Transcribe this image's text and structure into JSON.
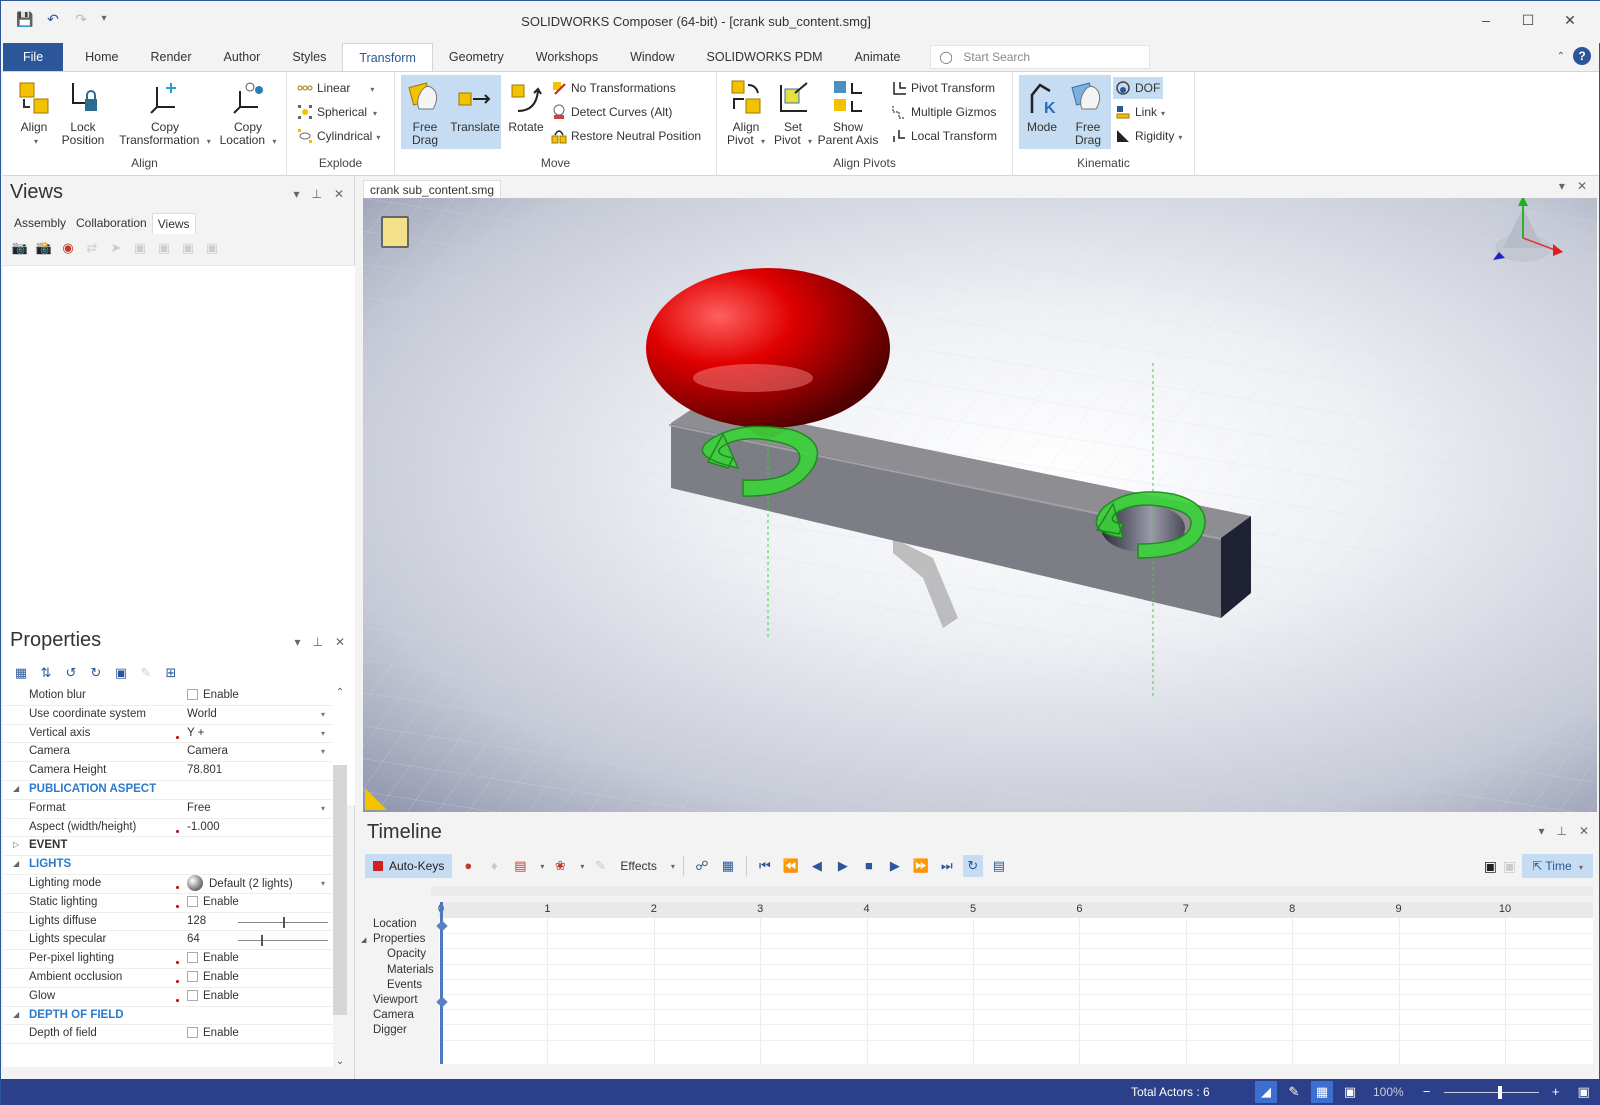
{
  "app": {
    "title": "SOLIDWORKS Composer (64-bit) - [crank sub_content.smg]",
    "quick_access": [
      "save-icon",
      "undo-icon",
      "redo-icon",
      "customize-icon"
    ],
    "window_controls": {
      "minimize": "–",
      "maximize": "☐",
      "close": "✕"
    }
  },
  "ribbon_tabs": [
    "File",
    "Home",
    "Render",
    "Author",
    "Styles",
    "Transform",
    "Geometry",
    "Workshops",
    "Window",
    "SOLIDWORKS PDM",
    "Animate"
  ],
  "active_tab": "Transform",
  "search": {
    "placeholder": "Start Search"
  },
  "ribbon": {
    "align": {
      "label": "Align",
      "buttons": [
        {
          "label": "Align",
          "icon": "align-icon",
          "dropdown": true
        },
        {
          "label": "Lock Position",
          "icon": "lock-position-icon"
        },
        {
          "label": "Copy Transformation",
          "icon": "copy-transformation-icon",
          "dropdown": true
        },
        {
          "label": "Copy Location",
          "icon": "copy-location-icon",
          "dropdown": true
        }
      ]
    },
    "explode": {
      "label": "Explode",
      "buttons": [
        {
          "label": "Linear",
          "icon": "linear-explode-icon"
        },
        {
          "label": "Spherical",
          "icon": "spherical-explode-icon"
        },
        {
          "label": "Cylindrical",
          "icon": "cylindrical-explode-icon"
        }
      ]
    },
    "move": {
      "label": "Move",
      "buttons": [
        {
          "label": "Free Drag",
          "icon": "free-drag-icon",
          "selected": true
        },
        {
          "label": "Translate",
          "icon": "translate-icon",
          "selected": true
        },
        {
          "label": "Rotate",
          "icon": "rotate-icon"
        },
        {
          "label": "No Transformations",
          "icon": "no-transformations-icon"
        },
        {
          "label": "Detect Curves (Alt)",
          "icon": "detect-curves-icon"
        },
        {
          "label": "Restore Neutral Position",
          "icon": "restore-neutral-icon"
        }
      ]
    },
    "align_pivots": {
      "label": "Align Pivots",
      "buttons": [
        {
          "label": "Align Pivot",
          "icon": "align-pivot-icon",
          "dropdown": true
        },
        {
          "label": "Set Pivot",
          "icon": "set-pivot-icon",
          "dropdown": true
        },
        {
          "label": "Show Parent Axis",
          "icon": "show-parent-axis-icon"
        },
        {
          "label": "Pivot Transform",
          "icon": "pivot-transform-icon"
        },
        {
          "label": "Multiple Gizmos",
          "icon": "multiple-gizmos-icon"
        },
        {
          "label": "Local Transform",
          "icon": "local-transform-icon"
        }
      ]
    },
    "kinematic": {
      "label": "Kinematic",
      "buttons": [
        {
          "label": "Mode",
          "icon": "kinematic-mode-icon",
          "selected": true
        },
        {
          "label": "Free Drag",
          "icon": "kinematic-free-drag-icon",
          "selected": true
        },
        {
          "label": "DOF",
          "icon": "dof-icon",
          "selected": true
        },
        {
          "label": "Link",
          "icon": "link-icon",
          "dropdown": true
        },
        {
          "label": "Rigidity",
          "icon": "rigidity-icon",
          "dropdown": true
        }
      ]
    }
  },
  "views_panel": {
    "title": "Views",
    "tabs": [
      "Assembly",
      "Collaboration",
      "Views"
    ],
    "active_tab": "Views"
  },
  "properties_panel": {
    "title": "Properties",
    "rows": [
      {
        "type": "prop",
        "label": "Motion blur",
        "value": "Enable",
        "control": "checkbox",
        "checked": false
      },
      {
        "type": "prop",
        "label": "Use coordinate system",
        "value": "World",
        "control": "dropdown"
      },
      {
        "type": "prop",
        "label": "Vertical axis",
        "value": "Y +",
        "control": "dropdown",
        "modified": true
      },
      {
        "type": "prop",
        "label": "Camera",
        "value": "Camera",
        "control": "dropdown"
      },
      {
        "type": "prop",
        "label": "Camera Height",
        "value": "78.801",
        "control": "text"
      },
      {
        "type": "section",
        "label": "PUBLICATION ASPECT",
        "expanded": true
      },
      {
        "type": "prop",
        "label": "Format",
        "value": "Free",
        "control": "dropdown"
      },
      {
        "type": "prop",
        "label": "Aspect (width/height)",
        "value": "-1.000",
        "control": "text",
        "modified": true
      },
      {
        "type": "section",
        "label": "EVENT",
        "expanded": false
      },
      {
        "type": "section",
        "label": "LIGHTS",
        "expanded": true
      },
      {
        "type": "prop",
        "label": "Lighting mode",
        "value": "Default (2 lights)",
        "control": "dropdown-sphere",
        "modified": true
      },
      {
        "type": "prop",
        "label": "Static lighting",
        "value": "Enable",
        "control": "checkbox",
        "checked": false,
        "modified": true
      },
      {
        "type": "prop",
        "label": "Lights diffuse",
        "value": "128",
        "control": "slider",
        "fraction": 0.5
      },
      {
        "type": "prop",
        "label": "Lights specular",
        "value": "64",
        "control": "slider",
        "fraction": 0.25
      },
      {
        "type": "prop",
        "label": "Per-pixel lighting",
        "value": "Enable",
        "control": "checkbox",
        "checked": false,
        "modified": true
      },
      {
        "type": "prop",
        "label": "Ambient occlusion",
        "value": "Enable",
        "control": "checkbox",
        "checked": false,
        "modified": true
      },
      {
        "type": "prop",
        "label": "Glow",
        "value": "Enable",
        "control": "checkbox",
        "checked": false,
        "modified": true
      },
      {
        "type": "section",
        "label": "DEPTH OF FIELD",
        "expanded": true
      },
      {
        "type": "prop",
        "label": "Depth of field",
        "value": "Enable",
        "control": "checkbox",
        "checked": false
      }
    ]
  },
  "document": {
    "tab": "crank sub_content.smg",
    "scene": {
      "knob_color": "#d80000",
      "plate_color": "#8c8c90",
      "gizmo_color": "#3cd23c",
      "axis_colors": {
        "x": "#e02020",
        "y": "#20b020",
        "z": "#2020c0"
      }
    }
  },
  "timeline": {
    "title": "Timeline",
    "autokeys_label": "Auto-Keys",
    "effects_label": "Effects",
    "time_mode_label": "Time",
    "tracks": [
      {
        "label": "Location",
        "indent": 0
      },
      {
        "label": "Properties",
        "indent": 0,
        "expanded": true
      },
      {
        "label": "Opacity",
        "indent": 1
      },
      {
        "label": "Materials",
        "indent": 1
      },
      {
        "label": "Events",
        "indent": 1
      },
      {
        "label": "Viewport",
        "indent": 0
      },
      {
        "label": "Camera",
        "indent": 0
      },
      {
        "label": "Digger",
        "indent": 0
      }
    ],
    "ruler_ticks": [
      "0",
      "1",
      "2",
      "3",
      "4",
      "5",
      "6",
      "7",
      "8",
      "9",
      "10"
    ],
    "current_time": 0
  },
  "statusbar": {
    "total_actors": "Total Actors : 6",
    "zoom": "100%",
    "zoom_fraction": 0.6
  }
}
